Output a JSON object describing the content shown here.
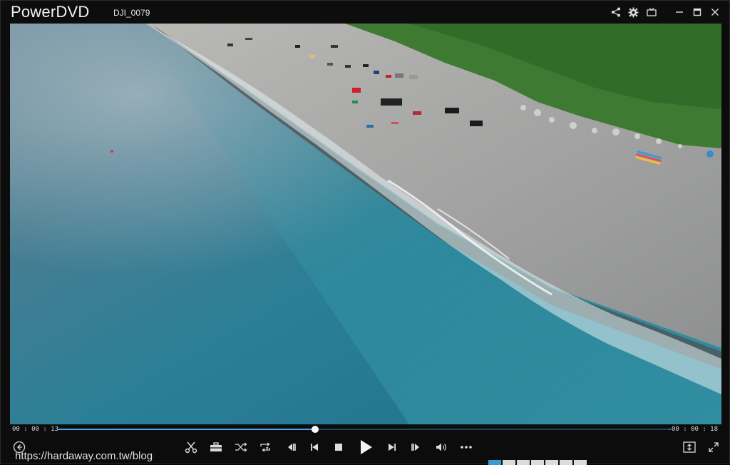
{
  "app": {
    "title": "PowerDVD",
    "file_name": "DJI_0079"
  },
  "title_bar": {
    "icons": [
      "share-icon",
      "gear-icon",
      "mini-mode-icon",
      "minimize-icon",
      "maximize-icon",
      "close-icon"
    ]
  },
  "player": {
    "elapsed": "00 : 00 : 13",
    "remaining": "-00 : 00 : 18",
    "progress": 0.42
  },
  "controls": {
    "icons": [
      "back-icon",
      "scissors-icon",
      "toolbox-icon",
      "shuffle-icon",
      "repeat-icon",
      "step-back-icon",
      "previous-icon",
      "stop-icon",
      "play-icon",
      "next-icon",
      "step-forward-icon",
      "volume-icon",
      "more-icon",
      "fullscreen-toggle-icon",
      "expand-icon"
    ]
  },
  "watermark": "https://hardaway.com.tw/blog",
  "colors": {
    "accent": "#4da3e8",
    "track": "#25435f",
    "background": "#0c0c0c"
  }
}
